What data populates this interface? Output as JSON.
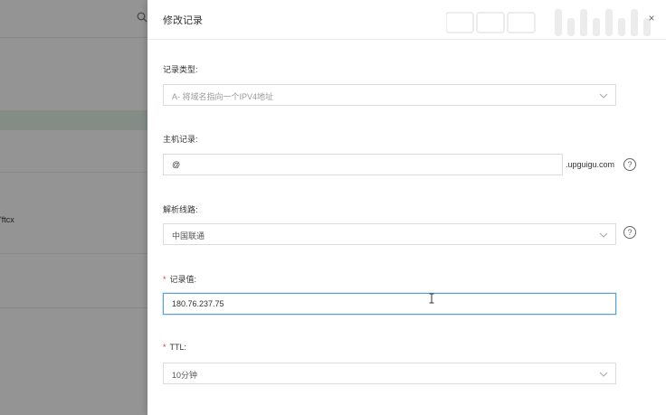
{
  "background": {
    "row_text": "'ftcx"
  },
  "drawer": {
    "title": "修改记录",
    "close_label": "×"
  },
  "form": {
    "record_type": {
      "label": "记录类型:",
      "value": "A- 将域名指向一个IPV4地址"
    },
    "host": {
      "label": "主机记录:",
      "value": "@",
      "suffix": ".upguigu.com"
    },
    "line": {
      "label": "解析线路:",
      "value": "中国联通"
    },
    "record_value": {
      "label": "记录值:",
      "required_mark": "*",
      "value": "180.76.237.75"
    },
    "ttl": {
      "label": "TTL:",
      "required_mark": "*",
      "value": "10分钟"
    }
  },
  "help_label": "?",
  "colors": {
    "focus_border": "#5aa0d8",
    "required": "#e53935",
    "overlay": "rgba(0,0,0,0.42)"
  }
}
